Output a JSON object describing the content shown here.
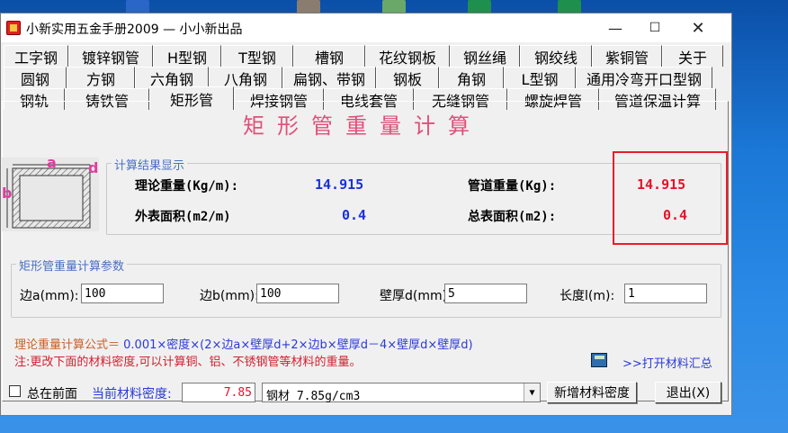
{
  "window": {
    "title": "小新实用五金手册2009 — 小小新出品"
  },
  "tabs": {
    "row1": [
      "工字钢",
      "镀锌钢管",
      "H型钢",
      "T型钢",
      "槽钢",
      "花纹钢板",
      "钢丝绳",
      "钢绞线",
      "紫铜管",
      "关于"
    ],
    "row2": [
      "圆钢",
      "方钢",
      "六角钢",
      "八角钢",
      "扁钢、带钢",
      "钢板",
      "角钢",
      "L型钢",
      "通用冷弯开口型钢"
    ],
    "row3": [
      "钢轨",
      "铸铁管",
      "矩形管",
      "焊接钢管",
      "电线套管",
      "无缝钢管",
      "螺旋焊管",
      "管道保温计算"
    ],
    "active": "矩形管"
  },
  "heading": "矩形管重量计算",
  "diagram": {
    "label_a": "a",
    "label_b": "b",
    "label_d": "d"
  },
  "results": {
    "group_title": "计算结果显示",
    "theory_weight_label": "理论重量(Kg/m):",
    "theory_weight_value": "14.915",
    "outer_area_label": "外表面积(m2/m)",
    "outer_area_value": "0.4",
    "pipe_weight_label": "管道重量(Kg):",
    "pipe_weight_value": "14.915",
    "total_area_label": "总表面积(m2):",
    "total_area_value": "0.4"
  },
  "params": {
    "group_title": "矩形管重量计算参数",
    "side_a_label": "边a(mm):",
    "side_a_value": "100",
    "side_b_label": "边b(mm):",
    "side_b_value": "100",
    "thickness_label": "壁厚d(mm)",
    "thickness_value": "5",
    "length_label": "长度l(m):",
    "length_value": "1"
  },
  "formula": {
    "label": "理论重量计算公式＝",
    "text": "0.001×密度×(2×边a×壁厚d+2×边b×壁厚d－4×壁厚d×壁厚d)"
  },
  "note": "注:更改下面的材料密度,可以计算铜、铝、不锈钢管等材料的重量。",
  "open_summary_link": ">>打开材料汇总",
  "bottom": {
    "always_on_top_label": "总在前面",
    "density_label": "当前材料密度:",
    "density_value": "7.85",
    "material_select": "钢材  7.85g/cm3",
    "add_density_button": "新增材料密度",
    "exit_button": "退出(X)"
  },
  "colors": {
    "heading": "#e0507a",
    "result_blue": "#1a30d8",
    "result_red": "#e2132b",
    "highlight_box": "#e81e2a"
  }
}
